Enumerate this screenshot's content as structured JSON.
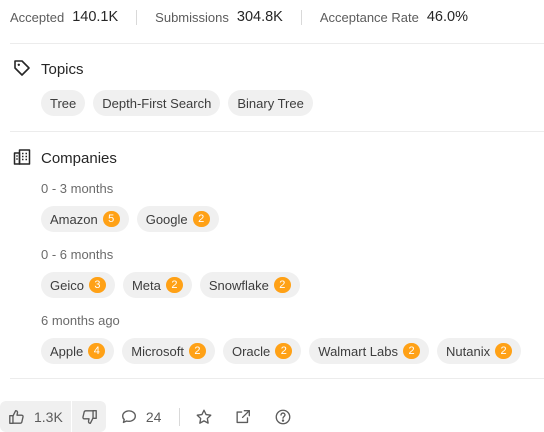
{
  "stats": [
    {
      "label": "Accepted",
      "value": "140.1K"
    },
    {
      "label": "Submissions",
      "value": "304.8K"
    },
    {
      "label": "Acceptance Rate",
      "value": "46.0%"
    }
  ],
  "topics": {
    "title": "Topics",
    "icon": "tag-icon",
    "tags": [
      "Tree",
      "Depth-First Search",
      "Binary Tree"
    ]
  },
  "companies": {
    "title": "Companies",
    "icon": "building-icon",
    "groups": [
      {
        "period": "0 - 3 months",
        "items": [
          {
            "name": "Amazon",
            "count": "5"
          },
          {
            "name": "Google",
            "count": "2"
          }
        ]
      },
      {
        "period": "0 - 6 months",
        "items": [
          {
            "name": "Geico",
            "count": "3"
          },
          {
            "name": "Meta",
            "count": "2"
          },
          {
            "name": "Snowflake",
            "count": "2"
          }
        ]
      },
      {
        "period": "6 months ago",
        "items": [
          {
            "name": "Apple",
            "count": "4"
          },
          {
            "name": "Microsoft",
            "count": "2"
          },
          {
            "name": "Oracle",
            "count": "2"
          },
          {
            "name": "Walmart Labs",
            "count": "2"
          },
          {
            "name": "Nutanix",
            "count": "2"
          }
        ]
      }
    ]
  },
  "footer": {
    "likes": "1.3K",
    "comments": "24",
    "icons": [
      "thumbs-up-icon",
      "thumbs-down-icon",
      "comment-icon",
      "star-icon",
      "share-icon",
      "help-icon"
    ]
  },
  "colors": {
    "badge": "#ffa116",
    "chip_bg": "#f0f0f0",
    "text": "#262626",
    "muted": "#5c5c5c"
  }
}
